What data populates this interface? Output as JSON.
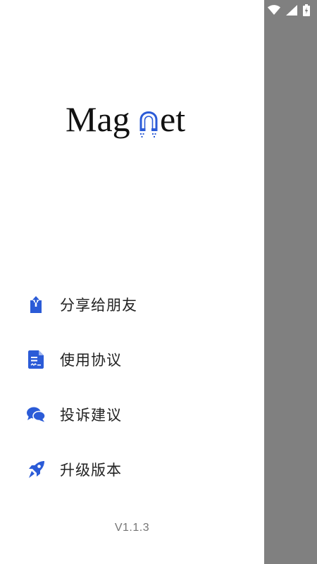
{
  "app": {
    "logo_text": "Magnet",
    "logo_accent_color": "#2b5bd7"
  },
  "status_bar": {
    "icons": [
      "wifi-icon",
      "cellular-signal-icon",
      "battery-charging-icon"
    ]
  },
  "menu": {
    "items": [
      {
        "label": "分享给朋友",
        "icon": "share-icon"
      },
      {
        "label": "使用协议",
        "icon": "agreement-document-icon"
      },
      {
        "label": "投诉建议",
        "icon": "chat-bubbles-icon"
      },
      {
        "label": "升级版本",
        "icon": "rocket-icon"
      }
    ]
  },
  "footer": {
    "version": "V1.1.3"
  },
  "colors": {
    "accent": "#2b5bd7",
    "scrim": "#808080",
    "drawer_bg": "#ffffff",
    "text": "#222222",
    "muted": "#757575"
  }
}
